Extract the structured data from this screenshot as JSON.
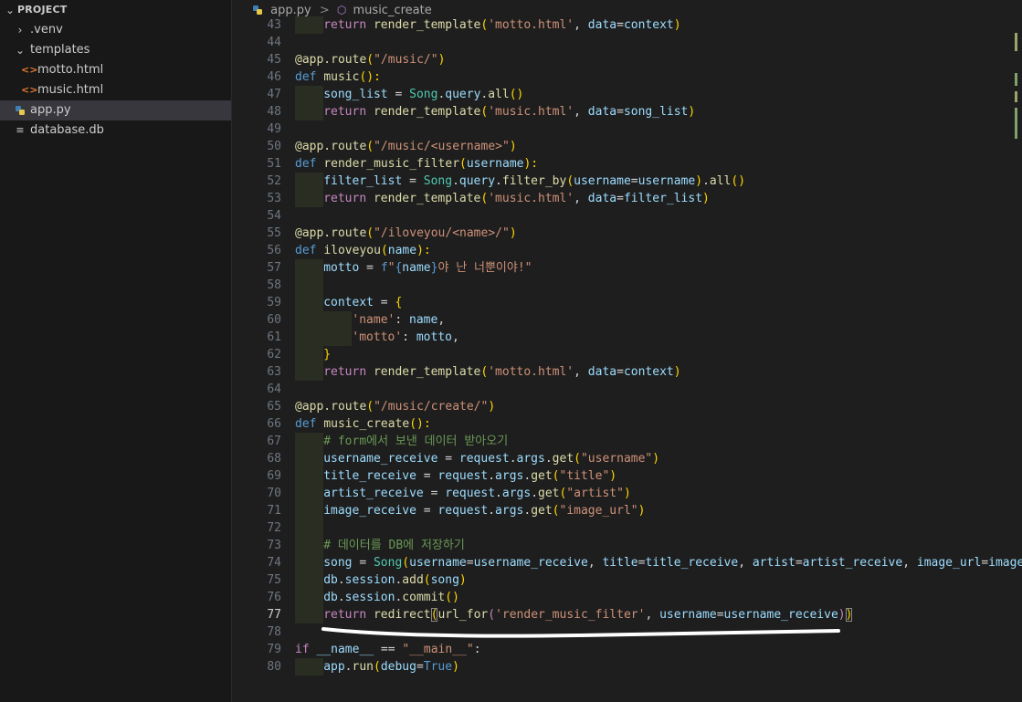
{
  "explorer": {
    "project": "PROJECT",
    "items": [
      {
        "label": ".venv",
        "type": "folder",
        "open": false
      },
      {
        "label": "templates",
        "type": "folder",
        "open": true
      },
      {
        "label": "motto.html",
        "type": "html"
      },
      {
        "label": "music.html",
        "type": "html"
      },
      {
        "label": "app.py",
        "type": "python",
        "selected": true
      },
      {
        "label": "database.db",
        "type": "db"
      }
    ]
  },
  "breadcrumb": {
    "file": "app.py",
    "separator": ">",
    "symbol": "music_create"
  },
  "editor": {
    "active_line": 77,
    "lines": [
      {
        "n": 43,
        "indent": 1,
        "tokens": [
          [
            "return",
            "ctl"
          ],
          [
            " ",
            ""
          ],
          [
            "render_template",
            "fn"
          ],
          [
            "(",
            "br"
          ],
          [
            "'motto.html'",
            "st"
          ],
          [
            ", ",
            ""
          ],
          [
            "data",
            "var"
          ],
          [
            "=",
            ""
          ],
          [
            "context",
            "var"
          ],
          [
            ")",
            "br"
          ]
        ]
      },
      {
        "n": 44,
        "indent": 0,
        "tokens": []
      },
      {
        "n": 45,
        "indent": 0,
        "tokens": [
          [
            "@app.route",
            "dec"
          ],
          [
            "(",
            "br"
          ],
          [
            "\"/music/\"",
            "st"
          ],
          [
            ")",
            "br"
          ]
        ]
      },
      {
        "n": 46,
        "indent": 0,
        "tokens": [
          [
            "def",
            "kw"
          ],
          [
            " ",
            ""
          ],
          [
            "music",
            "fn"
          ],
          [
            "():",
            "br"
          ]
        ]
      },
      {
        "n": 47,
        "indent": 1,
        "tokens": [
          [
            "song_list",
            "var"
          ],
          [
            " = ",
            ""
          ],
          [
            "Song",
            "cls"
          ],
          [
            ".",
            ""
          ],
          [
            "query",
            "var"
          ],
          [
            ".",
            ""
          ],
          [
            "all",
            "fn"
          ],
          [
            "()",
            "br"
          ]
        ]
      },
      {
        "n": 48,
        "indent": 1,
        "tokens": [
          [
            "return",
            "ctl"
          ],
          [
            " ",
            ""
          ],
          [
            "render_template",
            "fn"
          ],
          [
            "(",
            "br"
          ],
          [
            "'music.html'",
            "st"
          ],
          [
            ", ",
            ""
          ],
          [
            "data",
            "var"
          ],
          [
            "=",
            ""
          ],
          [
            "song_list",
            "var"
          ],
          [
            ")",
            "br"
          ]
        ]
      },
      {
        "n": 49,
        "indent": 0,
        "tokens": []
      },
      {
        "n": 50,
        "indent": 0,
        "tokens": [
          [
            "@app.route",
            "dec"
          ],
          [
            "(",
            "br"
          ],
          [
            "\"/music/<username>\"",
            "st"
          ],
          [
            ")",
            "br"
          ]
        ]
      },
      {
        "n": 51,
        "indent": 0,
        "tokens": [
          [
            "def",
            "kw"
          ],
          [
            " ",
            ""
          ],
          [
            "render_music_filter",
            "fn"
          ],
          [
            "(",
            "br"
          ],
          [
            "username",
            "var"
          ],
          [
            "):",
            "br"
          ]
        ]
      },
      {
        "n": 52,
        "indent": 1,
        "tokens": [
          [
            "filter_list",
            "var"
          ],
          [
            " = ",
            ""
          ],
          [
            "Song",
            "cls"
          ],
          [
            ".",
            ""
          ],
          [
            "query",
            "var"
          ],
          [
            ".",
            ""
          ],
          [
            "filter_by",
            "fn"
          ],
          [
            "(",
            "br"
          ],
          [
            "username",
            "var"
          ],
          [
            "=",
            ""
          ],
          [
            "username",
            "var"
          ],
          [
            ")",
            "br"
          ],
          [
            ".",
            ""
          ],
          [
            "all",
            "fn"
          ],
          [
            "()",
            "br"
          ]
        ]
      },
      {
        "n": 53,
        "indent": 1,
        "tokens": [
          [
            "return",
            "ctl"
          ],
          [
            " ",
            ""
          ],
          [
            "render_template",
            "fn"
          ],
          [
            "(",
            "br"
          ],
          [
            "'music.html'",
            "st"
          ],
          [
            ", ",
            ""
          ],
          [
            "data",
            "var"
          ],
          [
            "=",
            ""
          ],
          [
            "filter_list",
            "var"
          ],
          [
            ")",
            "br"
          ]
        ]
      },
      {
        "n": 54,
        "indent": 0,
        "tokens": []
      },
      {
        "n": 55,
        "indent": 0,
        "tokens": [
          [
            "@app.route",
            "dec"
          ],
          [
            "(",
            "br"
          ],
          [
            "\"/iloveyou/<name>/\"",
            "st"
          ],
          [
            ")",
            "br"
          ]
        ]
      },
      {
        "n": 56,
        "indent": 0,
        "tokens": [
          [
            "def",
            "kw"
          ],
          [
            " ",
            ""
          ],
          [
            "iloveyou",
            "fn"
          ],
          [
            "(",
            "br"
          ],
          [
            "name",
            "var"
          ],
          [
            "):",
            "br"
          ]
        ]
      },
      {
        "n": 57,
        "indent": 1,
        "tokens": [
          [
            "motto",
            "var"
          ],
          [
            " = ",
            ""
          ],
          [
            "f",
            "kw"
          ],
          [
            "\"",
            "st"
          ],
          [
            "{",
            "kw"
          ],
          [
            "name",
            "var"
          ],
          [
            "}",
            "kw"
          ],
          [
            "야 난 너뿐이야!\"",
            "st"
          ]
        ]
      },
      {
        "n": 58,
        "indent": 1,
        "tokens": []
      },
      {
        "n": 59,
        "indent": 1,
        "tokens": [
          [
            "context",
            "var"
          ],
          [
            " = ",
            ""
          ],
          [
            "{",
            "br"
          ]
        ]
      },
      {
        "n": 60,
        "indent": 2,
        "tokens": [
          [
            "'name'",
            "st"
          ],
          [
            ": ",
            ""
          ],
          [
            "name",
            "var"
          ],
          [
            ",",
            ""
          ]
        ]
      },
      {
        "n": 61,
        "indent": 2,
        "tokens": [
          [
            "'motto'",
            "st"
          ],
          [
            ": ",
            ""
          ],
          [
            "motto",
            "var"
          ],
          [
            ",",
            ""
          ]
        ]
      },
      {
        "n": 62,
        "indent": 1,
        "tokens": [
          [
            "}",
            "br"
          ]
        ]
      },
      {
        "n": 63,
        "indent": 1,
        "tokens": [
          [
            "return",
            "ctl"
          ],
          [
            " ",
            ""
          ],
          [
            "render_template",
            "fn"
          ],
          [
            "(",
            "br"
          ],
          [
            "'motto.html'",
            "st"
          ],
          [
            ", ",
            ""
          ],
          [
            "data",
            "var"
          ],
          [
            "=",
            ""
          ],
          [
            "context",
            "var"
          ],
          [
            ")",
            "br"
          ]
        ]
      },
      {
        "n": 64,
        "indent": 0,
        "tokens": []
      },
      {
        "n": 65,
        "indent": 0,
        "tokens": [
          [
            "@app.route",
            "dec"
          ],
          [
            "(",
            "br"
          ],
          [
            "\"/music/create/\"",
            "st"
          ],
          [
            ")",
            "br"
          ]
        ]
      },
      {
        "n": 66,
        "indent": 0,
        "tokens": [
          [
            "def",
            "kw"
          ],
          [
            " ",
            ""
          ],
          [
            "music_create",
            "fn"
          ],
          [
            "():",
            "br"
          ]
        ]
      },
      {
        "n": 67,
        "indent": 1,
        "tokens": [
          [
            "# form에서 보낸 데이터 받아오기",
            "cm"
          ]
        ]
      },
      {
        "n": 68,
        "indent": 1,
        "tokens": [
          [
            "username_receive",
            "var"
          ],
          [
            " = ",
            ""
          ],
          [
            "request",
            "var"
          ],
          [
            ".",
            ""
          ],
          [
            "args",
            "var"
          ],
          [
            ".",
            ""
          ],
          [
            "get",
            "fn"
          ],
          [
            "(",
            "br"
          ],
          [
            "\"username\"",
            "st"
          ],
          [
            ")",
            "br"
          ]
        ]
      },
      {
        "n": 69,
        "indent": 1,
        "tokens": [
          [
            "title_receive",
            "var"
          ],
          [
            " = ",
            ""
          ],
          [
            "request",
            "var"
          ],
          [
            ".",
            ""
          ],
          [
            "args",
            "var"
          ],
          [
            ".",
            ""
          ],
          [
            "get",
            "fn"
          ],
          [
            "(",
            "br"
          ],
          [
            "\"title\"",
            "st"
          ],
          [
            ")",
            "br"
          ]
        ]
      },
      {
        "n": 70,
        "indent": 1,
        "tokens": [
          [
            "artist_receive",
            "var"
          ],
          [
            " = ",
            ""
          ],
          [
            "request",
            "var"
          ],
          [
            ".",
            ""
          ],
          [
            "args",
            "var"
          ],
          [
            ".",
            ""
          ],
          [
            "get",
            "fn"
          ],
          [
            "(",
            "br"
          ],
          [
            "\"artist\"",
            "st"
          ],
          [
            ")",
            "br"
          ]
        ]
      },
      {
        "n": 71,
        "indent": 1,
        "tokens": [
          [
            "image_receive",
            "var"
          ],
          [
            " = ",
            ""
          ],
          [
            "request",
            "var"
          ],
          [
            ".",
            ""
          ],
          [
            "args",
            "var"
          ],
          [
            ".",
            ""
          ],
          [
            "get",
            "fn"
          ],
          [
            "(",
            "br"
          ],
          [
            "\"image_url\"",
            "st"
          ],
          [
            ")",
            "br"
          ]
        ]
      },
      {
        "n": 72,
        "indent": 1,
        "tokens": []
      },
      {
        "n": 73,
        "indent": 1,
        "tokens": [
          [
            "# 데이터를 DB에 저장하기",
            "cm"
          ]
        ]
      },
      {
        "n": 74,
        "indent": 1,
        "tokens": [
          [
            "song",
            "var"
          ],
          [
            " = ",
            ""
          ],
          [
            "Song",
            "cls"
          ],
          [
            "(",
            "br"
          ],
          [
            "username",
            "var"
          ],
          [
            "=",
            ""
          ],
          [
            "username_receive",
            "var"
          ],
          [
            ", ",
            ""
          ],
          [
            "title",
            "var"
          ],
          [
            "=",
            ""
          ],
          [
            "title_receive",
            "var"
          ],
          [
            ", ",
            ""
          ],
          [
            "artist",
            "var"
          ],
          [
            "=",
            ""
          ],
          [
            "artist_receive",
            "var"
          ],
          [
            ", ",
            ""
          ],
          [
            "image_url",
            "var"
          ],
          [
            "=",
            ""
          ],
          [
            "image_receive",
            "var"
          ],
          [
            ")",
            "br"
          ]
        ]
      },
      {
        "n": 75,
        "indent": 1,
        "tokens": [
          [
            "db",
            "var"
          ],
          [
            ".",
            ""
          ],
          [
            "session",
            "var"
          ],
          [
            ".",
            ""
          ],
          [
            "add",
            "fn"
          ],
          [
            "(",
            "br"
          ],
          [
            "song",
            "var"
          ],
          [
            ")",
            "br"
          ]
        ]
      },
      {
        "n": 76,
        "indent": 1,
        "tokens": [
          [
            "db",
            "var"
          ],
          [
            ".",
            ""
          ],
          [
            "session",
            "var"
          ],
          [
            ".",
            ""
          ],
          [
            "commit",
            "fn"
          ],
          [
            "()",
            "br"
          ]
        ]
      },
      {
        "n": 77,
        "indent": 1,
        "tokens": [
          [
            "return",
            "ctl"
          ],
          [
            " ",
            ""
          ],
          [
            "redirect",
            "fn"
          ],
          [
            "(",
            "br bm"
          ],
          [
            "url_for",
            "fn"
          ],
          [
            "(",
            "ctl"
          ],
          [
            "'render_music_filter'",
            "st"
          ],
          [
            ", ",
            ""
          ],
          [
            "username",
            "var"
          ],
          [
            "=",
            ""
          ],
          [
            "username_receive",
            "var"
          ],
          [
            ")",
            "ctl"
          ],
          [
            ")",
            "br bm"
          ]
        ]
      },
      {
        "n": 78,
        "indent": 0,
        "tokens": []
      },
      {
        "n": 79,
        "indent": 0,
        "tokens": [
          [
            "if",
            "ctl"
          ],
          [
            " ",
            ""
          ],
          [
            "__name__",
            "var"
          ],
          [
            " == ",
            ""
          ],
          [
            "\"__main__\"",
            "st"
          ],
          [
            ":",
            ""
          ]
        ]
      },
      {
        "n": 80,
        "indent": 1,
        "tokens": [
          [
            "app",
            "var"
          ],
          [
            ".",
            ""
          ],
          [
            "run",
            "fn"
          ],
          [
            "(",
            "br"
          ],
          [
            "debug",
            "var"
          ],
          [
            "=",
            ""
          ],
          [
            "True",
            "kw"
          ],
          [
            ")",
            "br"
          ]
        ]
      }
    ]
  }
}
